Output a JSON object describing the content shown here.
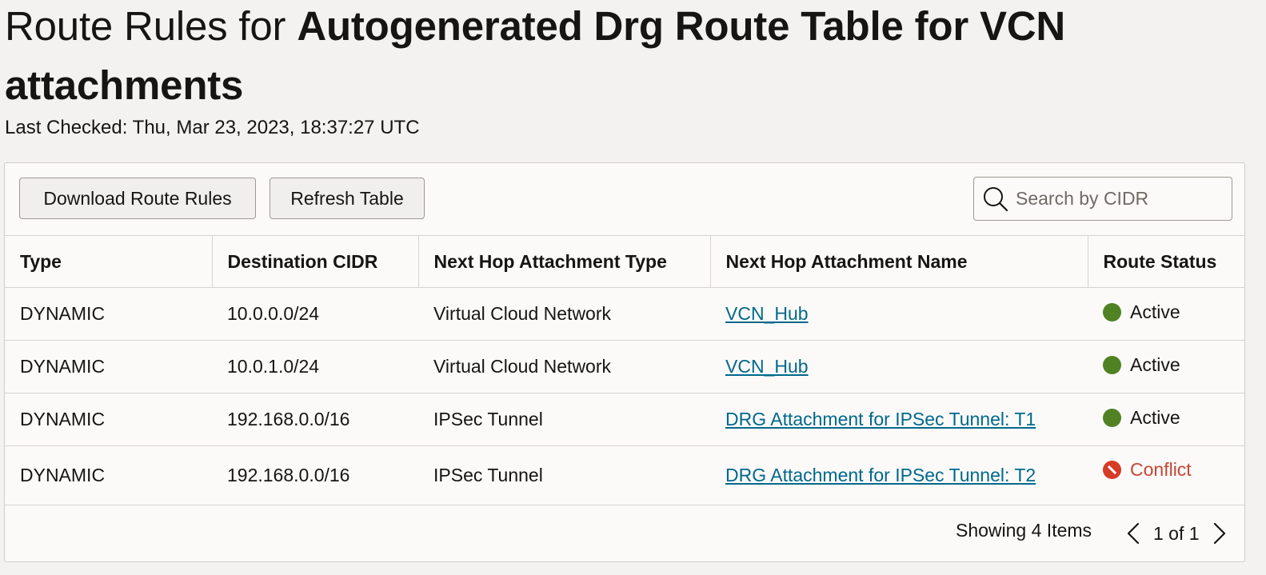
{
  "title": {
    "prefix": "Route Rules for ",
    "name": "Autogenerated Drg Route Table for VCN attachments"
  },
  "last_checked": "Last Checked: Thu, Mar 23, 2023, 18:37:27 UTC",
  "toolbar": {
    "download_label": "Download Route Rules",
    "refresh_label": "Refresh Table"
  },
  "search": {
    "placeholder": "Search by CIDR",
    "value": ""
  },
  "table": {
    "columns": [
      "Type",
      "Destination CIDR",
      "Next Hop Attachment Type",
      "Next Hop Attachment Name",
      "Route Status"
    ],
    "rows": [
      {
        "type": "DYNAMIC",
        "cidr": "10.0.0.0/24",
        "hop_type": "Virtual Cloud Network",
        "hop_name": "VCN_Hub",
        "status": "Active"
      },
      {
        "type": "DYNAMIC",
        "cidr": "10.0.1.0/24",
        "hop_type": "Virtual Cloud Network",
        "hop_name": "VCN_Hub",
        "status": "Active"
      },
      {
        "type": "DYNAMIC",
        "cidr": "192.168.0.0/16",
        "hop_type": "IPSec Tunnel",
        "hop_name": "DRG Attachment for IPSec Tunnel: T1",
        "status": "Active"
      },
      {
        "type": "DYNAMIC",
        "cidr": "192.168.0.0/16",
        "hop_type": "IPSec Tunnel",
        "hop_name": "DRG Attachment for IPSec Tunnel: T2",
        "status": "Conflict"
      }
    ]
  },
  "footer": {
    "showing": "Showing 4 Items",
    "page": "1 of 1"
  },
  "colors": {
    "active": "#508223",
    "conflict": "#d63b25",
    "link": "#00688c"
  },
  "icons": {
    "search": "search-icon",
    "prev": "chevron-left-icon",
    "next": "chevron-right-icon",
    "active": "status-active-dot-icon",
    "conflict": "status-conflict-icon"
  }
}
